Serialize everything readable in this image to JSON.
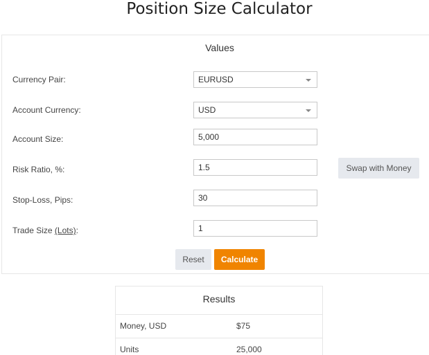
{
  "page": {
    "title": "Position Size Calculator"
  },
  "values": {
    "heading": "Values",
    "currency_pair": {
      "label": "Currency Pair:",
      "selected": "EURUSD"
    },
    "account_currency": {
      "label": "Account Currency:",
      "selected": "USD"
    },
    "account_size": {
      "label": "Account Size:",
      "value": "5,000"
    },
    "risk_ratio": {
      "label": "Risk Ratio, %:",
      "value": "1.5",
      "swap_label": "Swap with Money"
    },
    "stop_loss": {
      "label": "Stop-Loss, Pips:",
      "value": "30"
    },
    "trade_size": {
      "label_prefix": "Trade Size ",
      "label_link": "(Lots)",
      "label_suffix": ":",
      "value": "1"
    },
    "reset_label": "Reset",
    "calculate_label": "Calculate"
  },
  "results": {
    "heading": "Results",
    "rows": [
      {
        "label": "Money, USD",
        "value": "$75"
      },
      {
        "label": "Units",
        "value": "25,000"
      }
    ]
  },
  "colors": {
    "accent": "#f08400",
    "button_gray": "#e6e9ee",
    "border": "#e6e6e6"
  },
  "icons": {
    "dropdown": "chevron-down-icon"
  }
}
